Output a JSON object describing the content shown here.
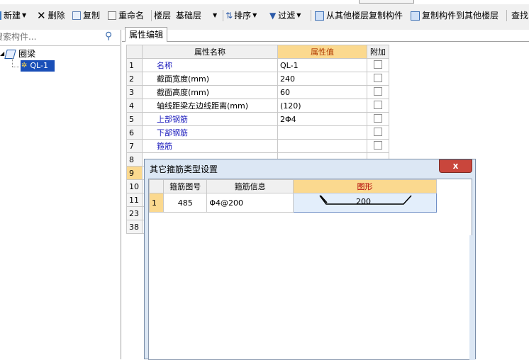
{
  "toolbar": {
    "new": "新建",
    "delete": "删除",
    "copy": "复制",
    "rename": "重命名",
    "floor_label": "楼层",
    "floor_value": "基础层",
    "sort": "排序",
    "filter": "过滤",
    "copy_from_floor": "从其他楼层复制构件",
    "copy_to_floor": "复制构件到其他楼层",
    "find": "查找"
  },
  "left": {
    "search_placeholder": "搜索构件...",
    "tree": {
      "group": "圈梁",
      "item": "QL-1"
    }
  },
  "attr_panel": {
    "tab": "属性编辑",
    "headers": {
      "name": "属性名称",
      "value": "属性值",
      "extra": "附加"
    },
    "rows": [
      {
        "num": "1",
        "name": "名称",
        "value": "QL-1"
      },
      {
        "num": "2",
        "name": "截面宽度(mm)",
        "value": "240"
      },
      {
        "num": "3",
        "name": "截面高度(mm)",
        "value": "60"
      },
      {
        "num": "4",
        "name": "轴线距梁左边线距离(mm)",
        "value": "(120)"
      },
      {
        "num": "5",
        "name": "上部钢筋",
        "value": "2Φ4"
      },
      {
        "num": "6",
        "name": "下部钢筋",
        "value": ""
      },
      {
        "num": "7",
        "name": "箍筋",
        "value": ""
      },
      {
        "num": "8",
        "name": "",
        "value": ""
      },
      {
        "num": "9",
        "name": "",
        "value": ""
      },
      {
        "num": "10",
        "name": "",
        "value": ""
      },
      {
        "num": "11",
        "name": "",
        "value": ""
      },
      {
        "num": "23",
        "name": "",
        "value": ""
      },
      {
        "num": "38",
        "name": "",
        "value": ""
      }
    ]
  },
  "dialog": {
    "title": "其它箍筋类型设置",
    "close": "x",
    "headers": {
      "id": "箍筋图号",
      "info": "箍筋信息",
      "shape": "图形"
    },
    "rows": [
      {
        "num": "1",
        "id": "485",
        "info": "Φ4@200",
        "shape_value": "200"
      }
    ]
  }
}
